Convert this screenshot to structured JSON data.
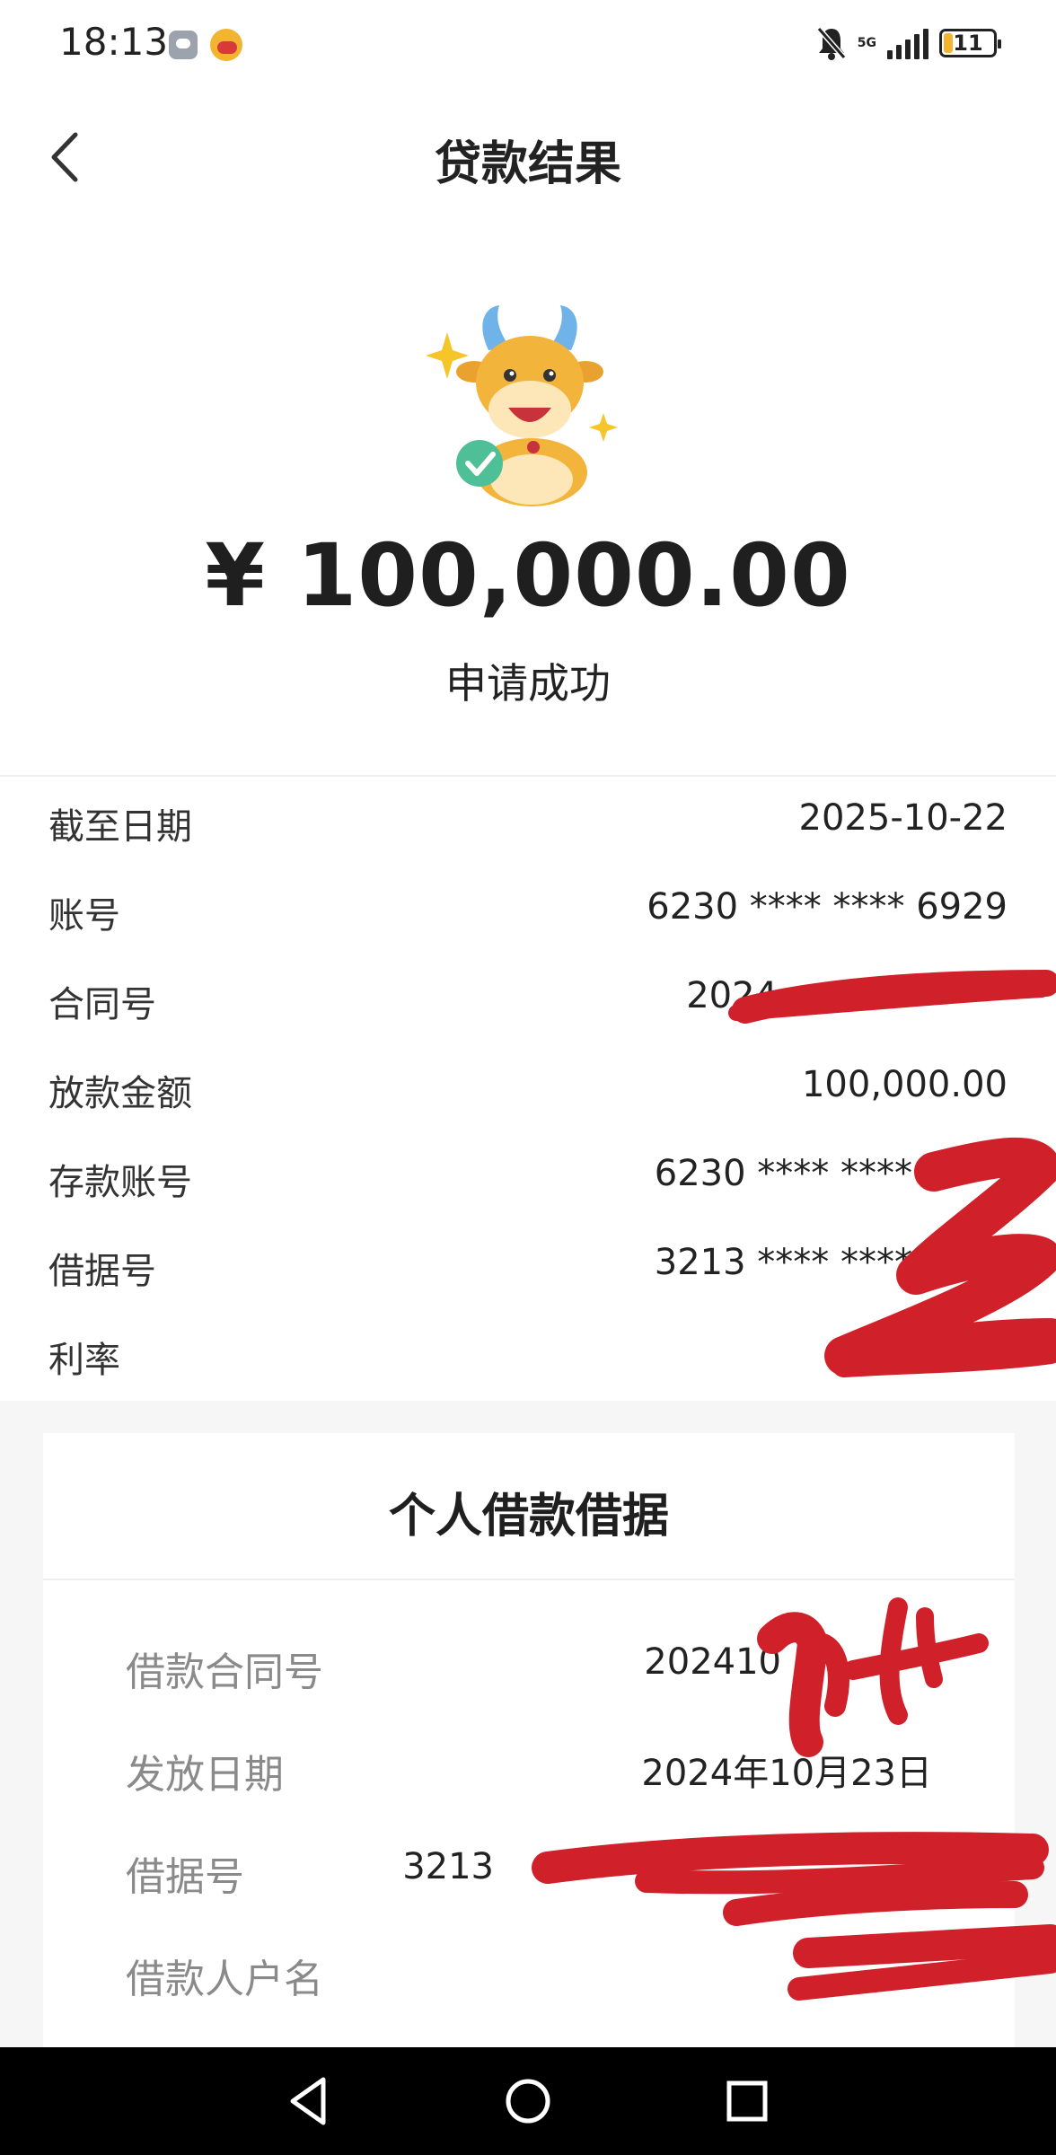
{
  "status_bar": {
    "time": "18:13",
    "network": "5G",
    "battery_level": "11",
    "icons": [
      "message-app-icon",
      "app-notification-icon",
      "bell-off-icon",
      "signal-icon",
      "battery-icon"
    ]
  },
  "nav": {
    "title": "贷款结果",
    "back_icon": "chevron-left-icon"
  },
  "result": {
    "amount": "¥ 100,000.00",
    "status": "申请成功",
    "mascot_icon": "mascot-ox-check-icon"
  },
  "details": [
    {
      "label": "截至日期",
      "value": "2025-10-22"
    },
    {
      "label": "账号",
      "value": "6230 **** **** 6929"
    },
    {
      "label": "合同号",
      "value": "2024"
    },
    {
      "label": "放款金额",
      "value": "100,000.00"
    },
    {
      "label": "存款账号",
      "value": "6230 **** ****"
    },
    {
      "label": "借据号",
      "value": "3213 **** ****"
    },
    {
      "label": "利率",
      "value": ""
    }
  ],
  "receipt": {
    "title": "个人借款借据",
    "rows": [
      {
        "label": "借款合同号",
        "value": "202410"
      },
      {
        "label": "发放日期",
        "value": "2024年10月23日"
      },
      {
        "label": "借据号",
        "value": "3213"
      },
      {
        "label": "借款人户名",
        "value": ""
      }
    ]
  },
  "system_nav": {
    "icons": [
      "back-triangle-icon",
      "home-circle-icon",
      "recents-square-icon"
    ]
  },
  "colors": {
    "background": "#ffffff",
    "gray_section": "#f6f6f6",
    "redaction": "#d0202a",
    "battery": "#f2b431"
  }
}
